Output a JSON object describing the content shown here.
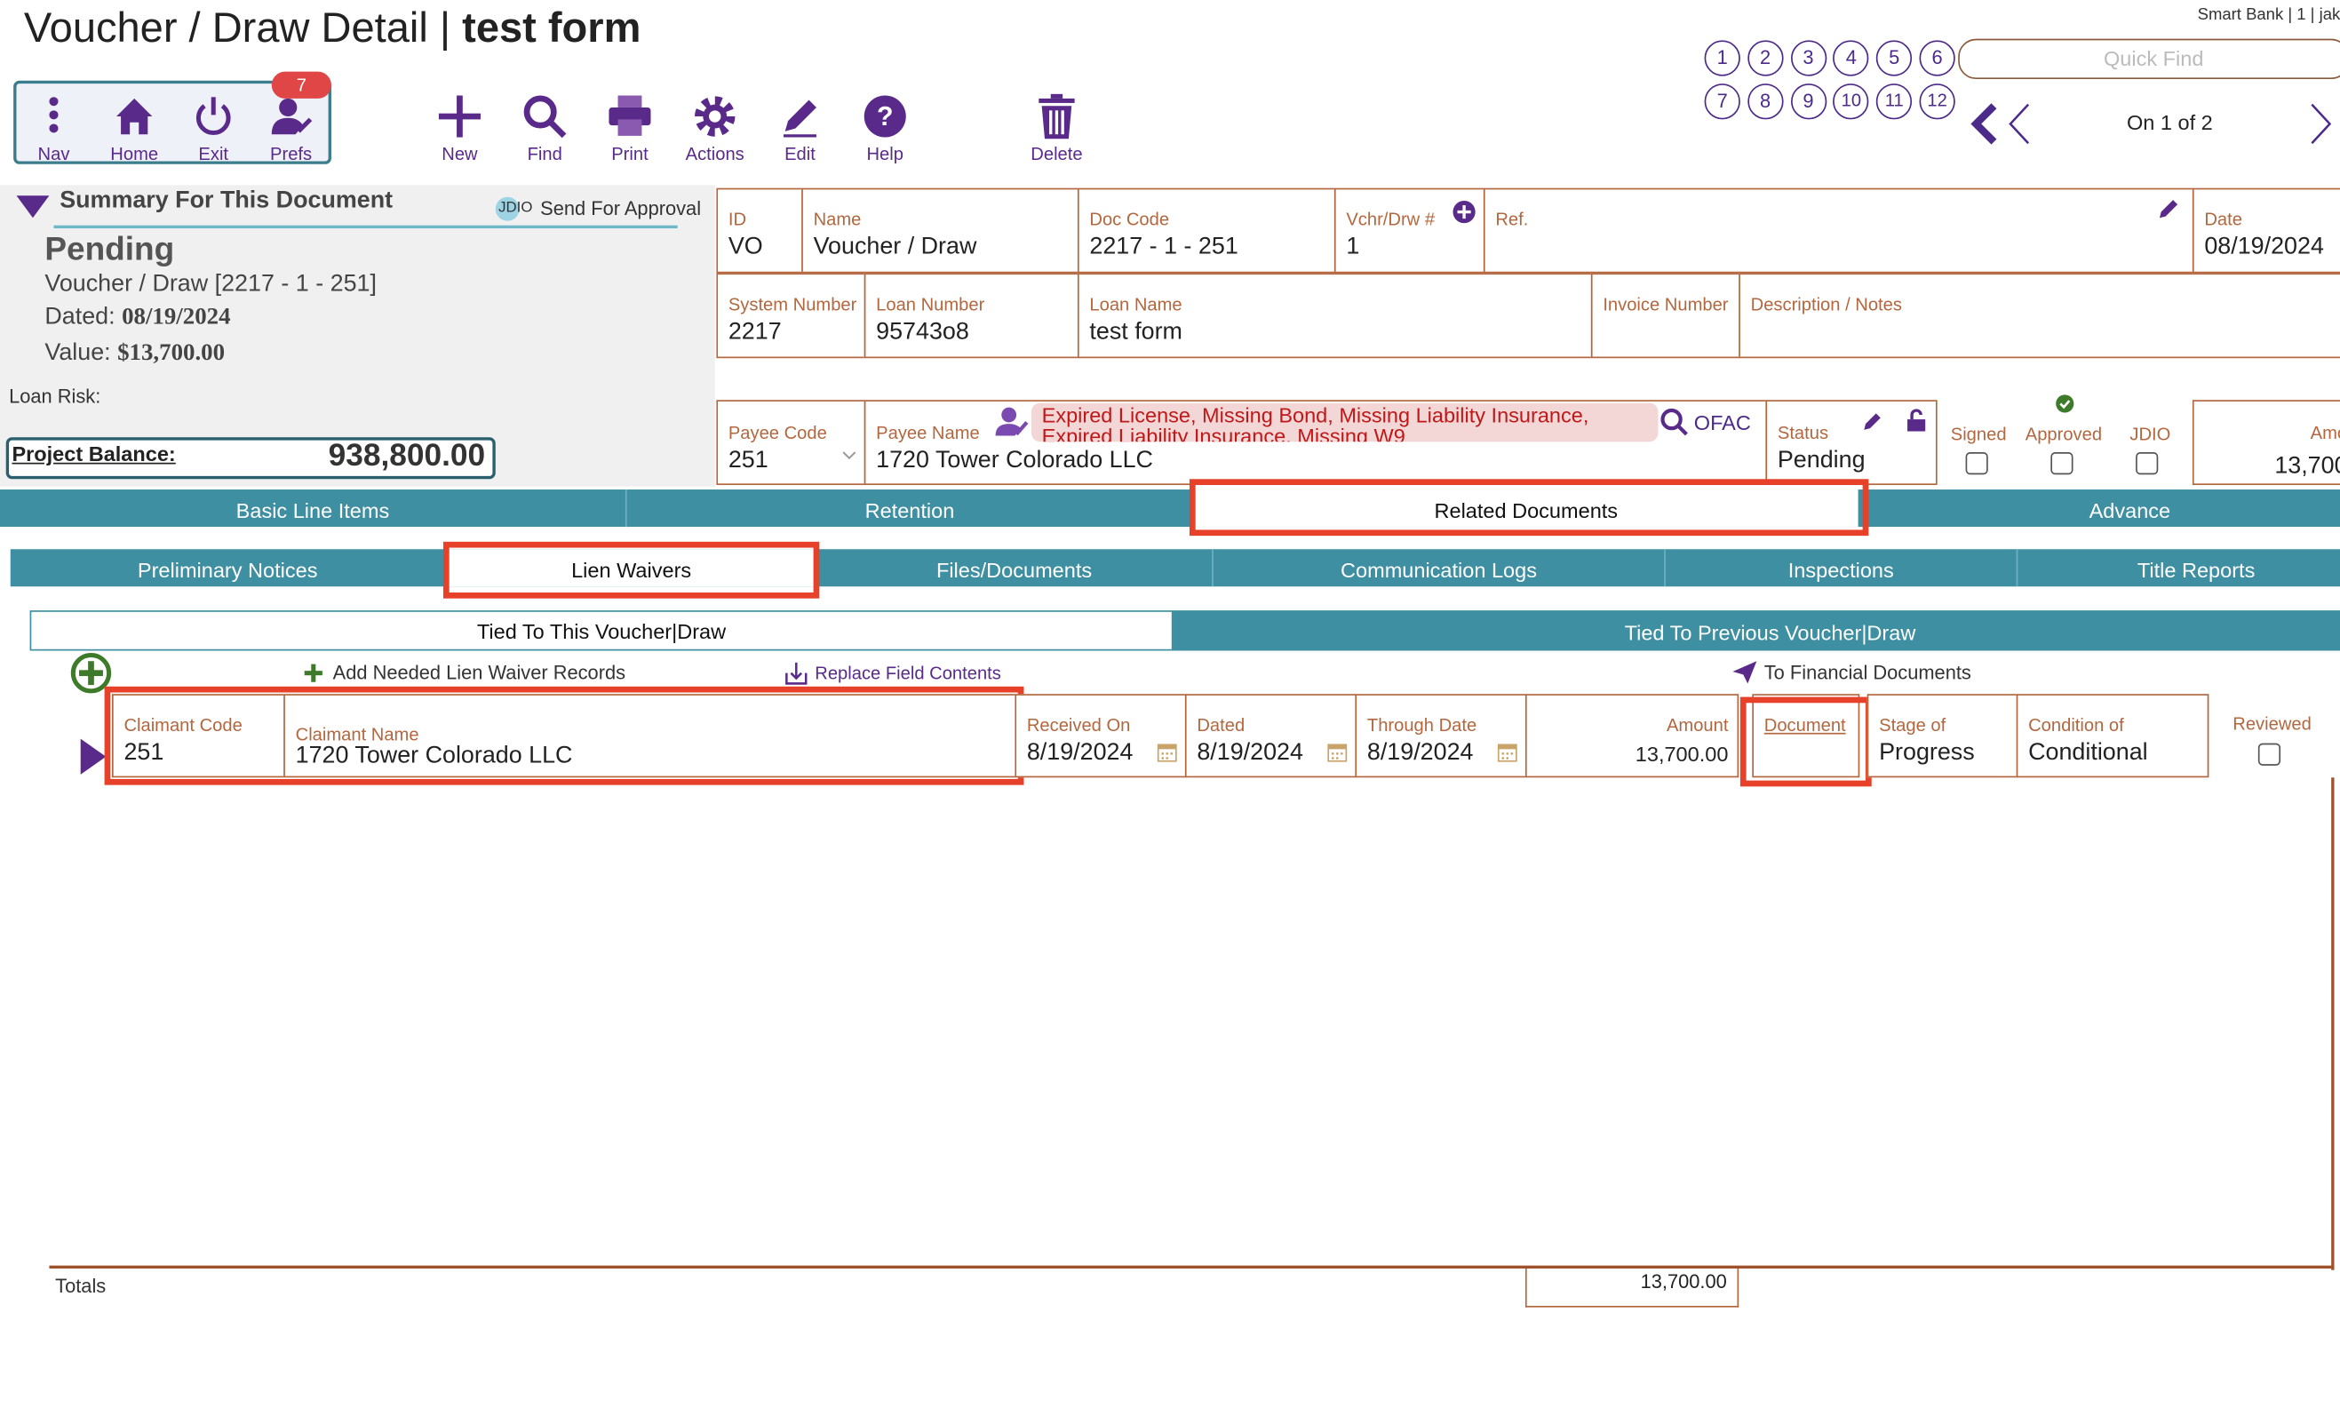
{
  "header": {
    "title_prefix": "Voucher / Draw Detail | ",
    "title_bold": "test form",
    "account": "Smart Bank | 1 | jak"
  },
  "toolbar": {
    "nav": "Nav",
    "home": "Home",
    "exit": "Exit",
    "prefs": "Prefs",
    "prefs_badge": "7",
    "new": "New",
    "find": "Find",
    "print": "Print",
    "actions": "Actions",
    "edit": "Edit",
    "help": "Help",
    "delete": "Delete"
  },
  "quick_links": [
    "1",
    "2",
    "3",
    "4",
    "5",
    "6",
    "7",
    "8",
    "9",
    "10",
    "11",
    "12"
  ],
  "quick_find_placeholder": "Quick Find",
  "record_nav": "On 1 of 2",
  "summary": {
    "heading": "Summary For This Document",
    "jdio": "JDIO",
    "send_approval": "Send For Approval",
    "status": "Pending",
    "doc_line": "Voucher / Draw  [2217 - 1 - 251]",
    "dated_label": "Dated: ",
    "dated_value": "08/19/2024",
    "value_label": "Value: ",
    "value_value": "$13,700.00",
    "loan_risk": "Loan Risk:",
    "project_balance_label": "Project Balance:",
    "project_balance": "938,800.00"
  },
  "fields": {
    "id": {
      "label": "ID",
      "value": "VO"
    },
    "name": {
      "label": "Name",
      "value": "Voucher / Draw"
    },
    "doc_code": {
      "label": "Doc Code",
      "value": "2217 - 1 - 251"
    },
    "vchr": {
      "label": "Vchr/Drw #",
      "value": "1"
    },
    "ref": {
      "label": "Ref.",
      "value": ""
    },
    "date": {
      "label": "Date",
      "value": "08/19/2024"
    },
    "system_number": {
      "label": "System Number",
      "value": "2217"
    },
    "loan_number": {
      "label": "Loan Number",
      "value": "95743o8"
    },
    "loan_name": {
      "label": "Loan Name",
      "value": "test form"
    },
    "invoice_number": {
      "label": "Invoice Number",
      "value": ""
    },
    "description": {
      "label": "Description / Notes",
      "value": ""
    },
    "payee_code": {
      "label": "Payee Code",
      "value": "251"
    },
    "payee_name": {
      "label": "Payee Name",
      "value": "1720 Tower Colorado LLC"
    },
    "warning_line1": "Expired License, Missing Bond, Missing Liability Insurance,",
    "warning_line2": "Expired Liability Insurance, Missing W9",
    "ofac": "OFAC",
    "status": {
      "label": "Status",
      "value": "Pending"
    },
    "signed": "Signed",
    "approved": "Approved",
    "jdio": "JDIO",
    "amount": {
      "label": "Amo",
      "value": "13,700"
    }
  },
  "main_tabs": [
    "Basic Line Items",
    "Retention",
    "Related Documents",
    "Advance"
  ],
  "sub_tabs": [
    "Preliminary Notices",
    "Lien Waivers",
    "Files/Documents",
    "Communication Logs",
    "Inspections",
    "Title Reports"
  ],
  "tie_tabs": [
    "Tied To This Voucher|Draw",
    "Tied To Previous Voucher|Draw"
  ],
  "actions": {
    "add_needed": "Add Needed Lien Waiver Records",
    "replace": "Replace Field Contents",
    "to_financial": "To Financial Documents"
  },
  "lien_row": {
    "claimant_code": {
      "label": "Claimant Code",
      "value": "251"
    },
    "claimant_name": {
      "label": "Claimant Name",
      "value": "1720 Tower Colorado LLC"
    },
    "received_on": {
      "label": "Received On",
      "value": "8/19/2024"
    },
    "dated": {
      "label": "Dated",
      "value": "8/19/2024"
    },
    "through_date": {
      "label": "Through Date",
      "value": "8/19/2024"
    },
    "amount": {
      "label": "Amount",
      "value": "13,700.00"
    },
    "document": {
      "label": "Document",
      "value": ""
    },
    "stage": {
      "label": "Stage of",
      "value": "Progress"
    },
    "condition": {
      "label": "Condition of",
      "value": "Conditional"
    },
    "reviewed": "Reviewed"
  },
  "totals": {
    "label": "Totals",
    "amount": "13,700.00"
  },
  "colors": {
    "accent": "#5a2a8a",
    "teal": "#3f8fa2",
    "orange": "#b3673f",
    "highlight": "#e8412a"
  }
}
